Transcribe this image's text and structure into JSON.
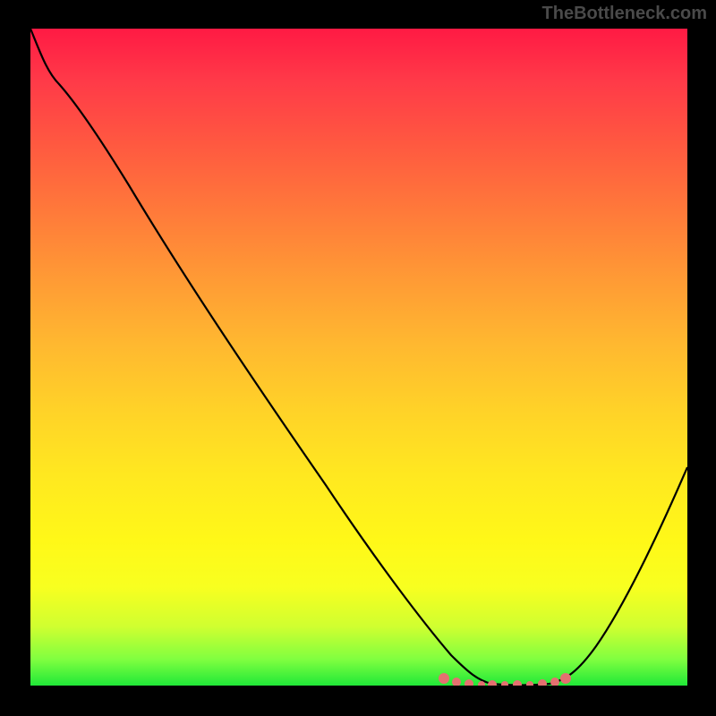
{
  "watermark": "TheBottleneck.com",
  "chart_data": {
    "type": "line",
    "title": "",
    "xlabel": "",
    "ylabel": "",
    "xlim": [
      0,
      100
    ],
    "ylim": [
      0,
      100
    ],
    "grid": false,
    "legend": false,
    "background": "red-yellow-green vertical gradient (high value top = bad/red, low value bottom = good/green)",
    "series": [
      {
        "name": "bottleneck-curve",
        "x": [
          0,
          3,
          8,
          15,
          25,
          35,
          45,
          55,
          62,
          66,
          68,
          70,
          74,
          78,
          80,
          82,
          86,
          92,
          100
        ],
        "y": [
          100,
          96,
          92,
          84,
          72,
          60,
          47,
          33,
          20,
          10,
          4,
          1,
          0,
          0,
          0,
          1,
          5,
          15,
          35
        ],
        "color": "#000000"
      },
      {
        "name": "sweet-spot-highlight",
        "x": [
          62,
          80
        ],
        "y": [
          0,
          0
        ],
        "color": "#e86a6a",
        "style": "thick-dotted"
      }
    ],
    "annotations": []
  }
}
